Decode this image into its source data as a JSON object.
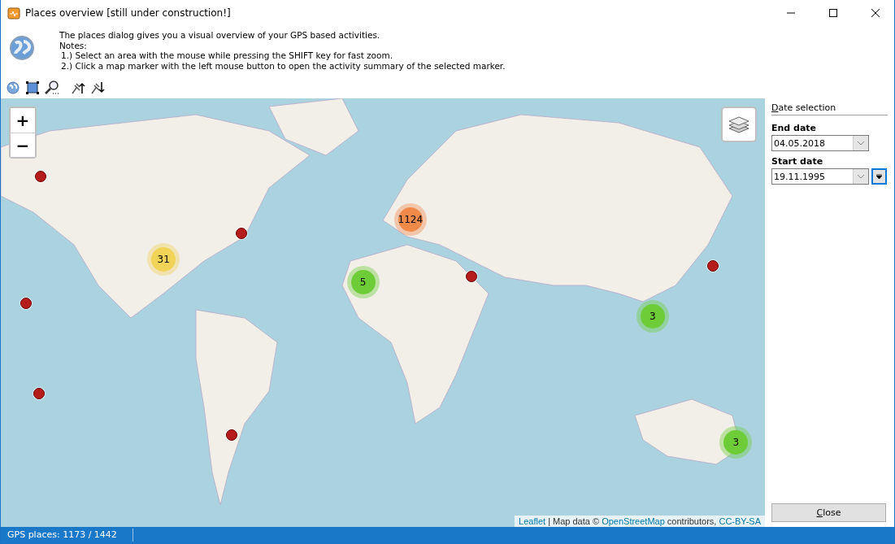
{
  "window": {
    "title": "Places overview [still under construction!]"
  },
  "header": {
    "lines": [
      "The places dialog gives you a visual overview of your GPS based activities.",
      "Notes:",
      "1.) Select an area with the mouse while pressing the SHIFT key for fast zoom.",
      "2.) Click a map marker with the left mouse button to open the activity summary of the selected marker."
    ]
  },
  "map": {
    "zoom_in": "+",
    "zoom_out": "−",
    "clusters": [
      {
        "count": "1124",
        "color": "#f08a4b"
      },
      {
        "count": "31",
        "color": "#f1d357"
      },
      {
        "count": "5",
        "color": "#6ecc39"
      },
      {
        "count": "3",
        "color": "#6ecc39"
      },
      {
        "count": "3",
        "color": "#6ecc39"
      }
    ],
    "attribution": [
      {
        "kind": "link",
        "text": "Leaflet"
      },
      {
        "kind": "text",
        "text": " | Map data © "
      },
      {
        "kind": "link",
        "text": "OpenStreetMap"
      },
      {
        "kind": "text",
        "text": " contributors, "
      },
      {
        "kind": "link",
        "text": "CC-BY-SA"
      }
    ]
  },
  "date_selection": {
    "title": "Date selection",
    "end_label": "End date",
    "end_date": "04.05.2018",
    "start_label": "Start date",
    "start_date": "19.11.1995"
  },
  "close_button": "Close",
  "status_bar": "GPS places: 1173 / 1442"
}
